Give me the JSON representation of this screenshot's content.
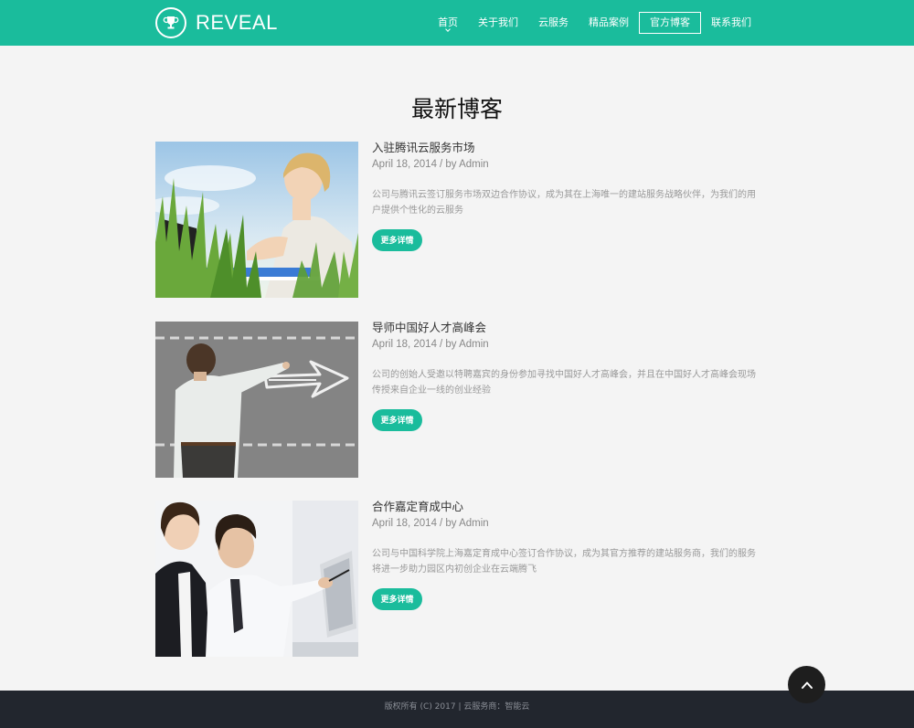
{
  "header": {
    "logo_text": "REVEAL",
    "logo_icon": "trophy-icon",
    "nav": [
      {
        "label": "首页"
      },
      {
        "label": "关于我们"
      },
      {
        "label": "云服务"
      },
      {
        "label": "精品案例"
      },
      {
        "label": "官方博客"
      },
      {
        "label": "联系我们"
      }
    ]
  },
  "main": {
    "title": "最新博客",
    "posts": [
      {
        "title": "入驻腾讯云服务市场",
        "date": "April 18, 2014",
        "author": "/ by Admin",
        "desc": "公司与腾讯云签订服务市场双边合作协议，成为其在上海唯一的建站服务战略伙伴，为我们的用户提供个性化的云服务",
        "button": "更多详情"
      },
      {
        "title": "导师中国好人才高峰会",
        "date": "April 18, 2014",
        "author": "/ by Admin",
        "desc": "公司的创始人受邀以特聘嘉宾的身份参加寻找中国好人才高峰会，并且在中国好人才高峰会现场传授来自企业一线的创业经验",
        "button": "更多详情"
      },
      {
        "title": "合作嘉定育成中心",
        "date": "April 18, 2014",
        "author": "/ by Admin",
        "desc": "公司与中国科学院上海嘉定育成中心签订合作协议，成为其官方推荐的建站服务商，我们的服务将进一步助力园区内初创企业在云端腾飞",
        "button": "更多详情"
      }
    ]
  },
  "footer": {
    "text": "版权所有 (C) 2017 | 云服务商：智能云"
  },
  "colors": {
    "accent": "#1abc9c",
    "footer_bg": "#22262e"
  }
}
